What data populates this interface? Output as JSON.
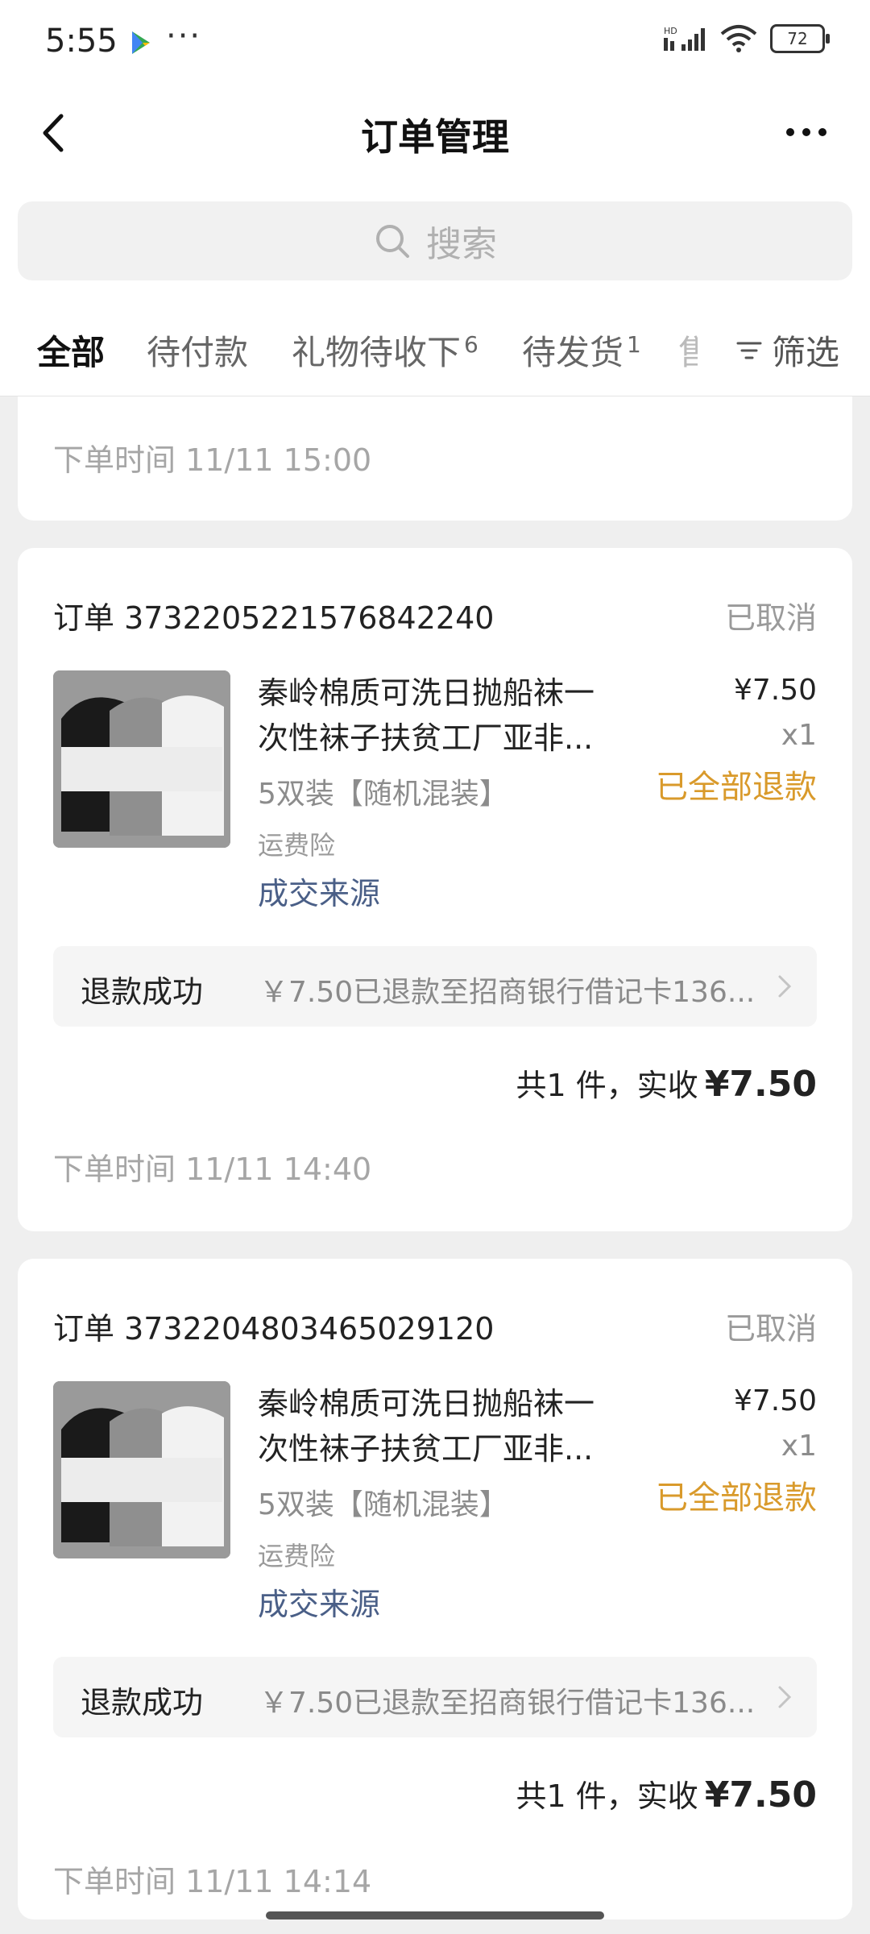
{
  "status_bar": {
    "time": "5:55",
    "dots": "···",
    "network_label": "HD",
    "battery": "72"
  },
  "nav": {
    "title": "订单管理"
  },
  "search": {
    "placeholder": "搜索"
  },
  "tabs": [
    {
      "label": "全部",
      "count": "",
      "active": true
    },
    {
      "label": "待付款",
      "count": "",
      "active": false
    },
    {
      "label": "礼物待收下",
      "count": "6",
      "active": false
    },
    {
      "label": "待发货",
      "count": "1",
      "active": false
    },
    {
      "label": "售",
      "count": "",
      "active": false
    }
  ],
  "filter_label": "筛选",
  "orders": [
    {
      "partial": true,
      "order_time": "下单时间 11/11 15:00"
    },
    {
      "order_label": "订单 3732205221576842240",
      "status": "已取消",
      "product_title_line1": "秦岭棉质可洗日抛船袜一",
      "product_title_line2": "次性袜子扶贫工厂亚非...",
      "spec": "5双装【随机混装】",
      "insurance": "运费险",
      "source_link": "成交来源",
      "price": "¥7.50",
      "quantity": "x1",
      "refund_status": "已全部退款",
      "refund_label": "退款成功",
      "refund_detail": "￥7.50已退款至招商银行借记卡136...",
      "total_text": "共1 件，实收",
      "total_amount": "¥7.50",
      "order_time": "下单时间 11/11 14:40"
    },
    {
      "order_label": "订单 3732204803465029120",
      "status": "已取消",
      "product_title_line1": "秦岭棉质可洗日抛船袜一",
      "product_title_line2": "次性袜子扶贫工厂亚非...",
      "spec": "5双装【随机混装】",
      "insurance": "运费险",
      "source_link": "成交来源",
      "price": "¥7.50",
      "quantity": "x1",
      "refund_status": "已全部退款",
      "refund_label": "退款成功",
      "refund_detail": "￥7.50已退款至招商银行借记卡136...",
      "total_text": "共1 件，实收",
      "total_amount": "¥7.50",
      "order_time": "下单时间 11/11 14:14"
    }
  ],
  "colors": {
    "accent_refund": "#d99a2b",
    "link": "#4a5f87",
    "muted": "#a6a6a6",
    "background": "#efefef"
  }
}
